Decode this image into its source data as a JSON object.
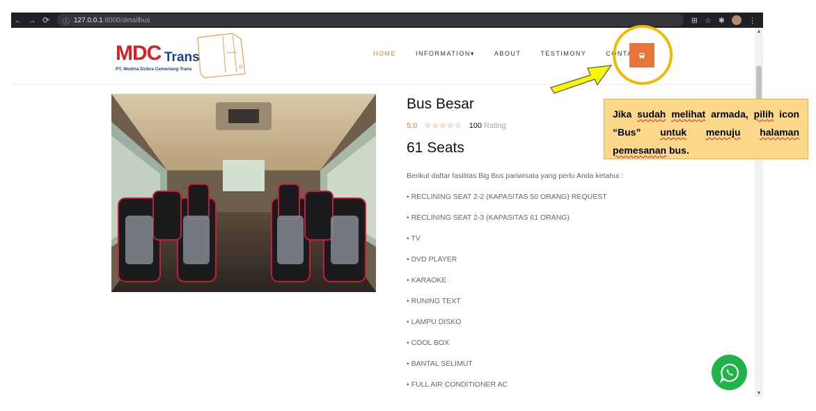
{
  "browser": {
    "url_host": "127.0.0.1",
    "url_port_path": ":8000/detailbus",
    "nav_icons": [
      "back-icon",
      "forward-icon",
      "reload-icon"
    ]
  },
  "header": {
    "logo_main": "MDC",
    "logo_trans": "Trans",
    "logo_sub": "PT. Medina Dzikra Cemerlang Trans",
    "nav": [
      "HOME",
      "INFORMATION",
      "ABOUT",
      "TESTIMONY",
      "CONTACT"
    ],
    "nav_active": "HOME",
    "bus_icon": "bus-icon"
  },
  "detail": {
    "title": "Bus Besar",
    "rating_score": "5.0",
    "stars": "☆☆☆☆☆",
    "rating_count": "100",
    "rating_label": "Rating",
    "seats": "61 Seats",
    "intro": "Berikut daftar fasilitas Big Bus pariwisata yang perlu Anda ketahui :",
    "facilities": [
      "• RECLINING SEAT 2-2 (KAPASITAS 50 ORANG) REQUEST",
      "• RECLINING SEAT 2-3 (KAPASITAS 61 ORANG)",
      "• TV",
      "• DVD PLAYER",
      "• KARAOKE",
      "• RUNING TEXT",
      "• LAMPU DISKO",
      "• COOL BOX",
      "• BANTAL SELIMUT",
      "• FULL AIR CONDITIONER AC"
    ]
  },
  "annotation": {
    "w1": "Jika",
    "w2": "sudah",
    "w3": "melihat",
    "w4": "armada,",
    "w5": "pilih",
    "line2a": "icon “Bus”",
    "w6": "untuk",
    "w7": "menuju",
    "w8": "halaman",
    "w9": "pemesanan",
    "w10": "bus."
  },
  "colors": {
    "accent": "#e8743b",
    "highlight": "#f5b800",
    "note_bg": "#fcd98a",
    "whatsapp": "#1fb44a"
  }
}
